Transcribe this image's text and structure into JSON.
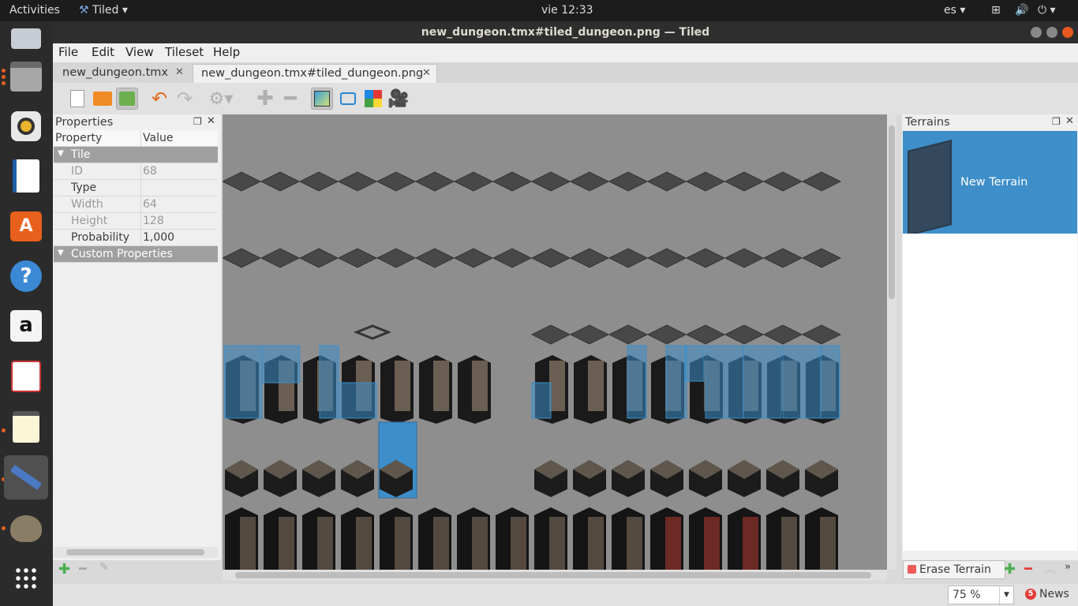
{
  "topbar": {
    "activities": "Activities",
    "app": "Tiled",
    "clock": "vie 12:33",
    "lang": "es"
  },
  "window": {
    "title": "new_dungeon.tmx#tiled_dungeon.png — Tiled"
  },
  "menu": [
    "File",
    "Edit",
    "View",
    "Tileset",
    "Help"
  ],
  "tabs": [
    "new_dungeon.tmx",
    "new_dungeon.tmx#tiled_dungeon.png"
  ],
  "properties": {
    "title": "Properties",
    "header": {
      "property": "Property",
      "value": "Value"
    },
    "group_tile": "Tile",
    "rows": [
      {
        "k": "ID",
        "v": "68",
        "readonly": true
      },
      {
        "k": "Type",
        "v": "",
        "readonly": false
      },
      {
        "k": "Width",
        "v": "64",
        "readonly": true
      },
      {
        "k": "Height",
        "v": "128",
        "readonly": true
      },
      {
        "k": "Probability",
        "v": "1,000",
        "readonly": false
      }
    ],
    "group_custom": "Custom Properties"
  },
  "terrains": {
    "title": "Terrains",
    "items": [
      {
        "name": "New Terrain"
      }
    ],
    "erase": "Erase Terrain"
  },
  "status": {
    "zoom": "75 %",
    "news": "News"
  },
  "colors": {
    "accent": "#3d8ec9",
    "canvas": "#8e8e8e",
    "terrain_overlay": "#3d8ec9"
  },
  "launcher_icons": [
    "mail-icon",
    "files-icon",
    "rhythmbox-icon",
    "writer-icon",
    "software-center-icon",
    "help-icon",
    "amazon-icon",
    "document-viewer-icon",
    "text-editor-icon",
    "tiled-icon",
    "gimp-icon",
    "apps-grid-icon"
  ]
}
